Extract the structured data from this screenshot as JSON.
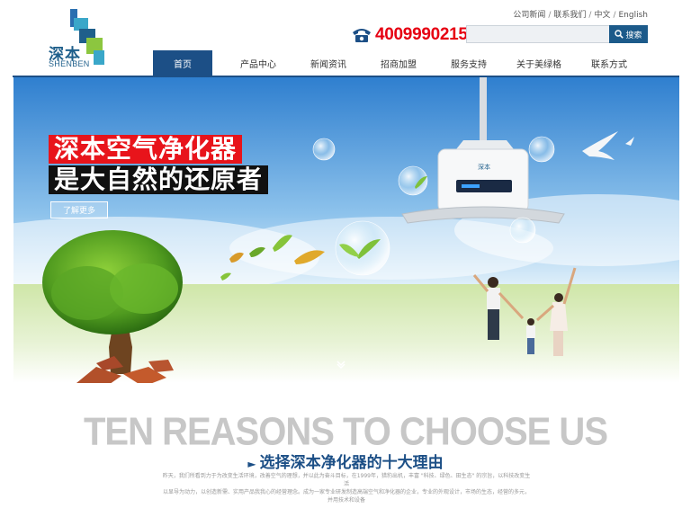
{
  "brand": {
    "name_cn": "深本",
    "name_en": "SHENBEN"
  },
  "top_links": [
    "公司新闻",
    "联系我们",
    "中文",
    "English"
  ],
  "phone": "4009990215",
  "search": {
    "placeholder": "",
    "button_label": "搜索"
  },
  "nav": {
    "items": [
      "首页",
      "产品中心",
      "新闻资讯",
      "招商加盟",
      "服务支持",
      "关于美绿格",
      "联系方式"
    ],
    "active_index": 0
  },
  "banner": {
    "slogan_line1": "深本空气净化器",
    "slogan_line2": "是大自然的还原者",
    "more_button": "了解更多",
    "purifier_label": "深本"
  },
  "reasons": {
    "title": "TEN REASONS TO CHOOSE US",
    "subtitle": "选择深本净化器的十大理由",
    "text_line1": "昨天，我们所看到力于为改变生活环境，改善空气的理想，并以此为奋斗目标，在1999年，猎豹出机，丰富 \"科技、绿色、田生态\" 的宗旨，以科技改变生活",
    "text_line2": "以显导为动力，以创造新需、实用产品我我心的经营理念。成为一家专业研发制造高端空气和净化器的企业，专业的外观设计，市场的生态，经营的多元，并用技术和设备"
  },
  "colors": {
    "brand_blue": "#1c4f86",
    "phone_red": "#e60012",
    "slogan_red": "#e8141b"
  }
}
